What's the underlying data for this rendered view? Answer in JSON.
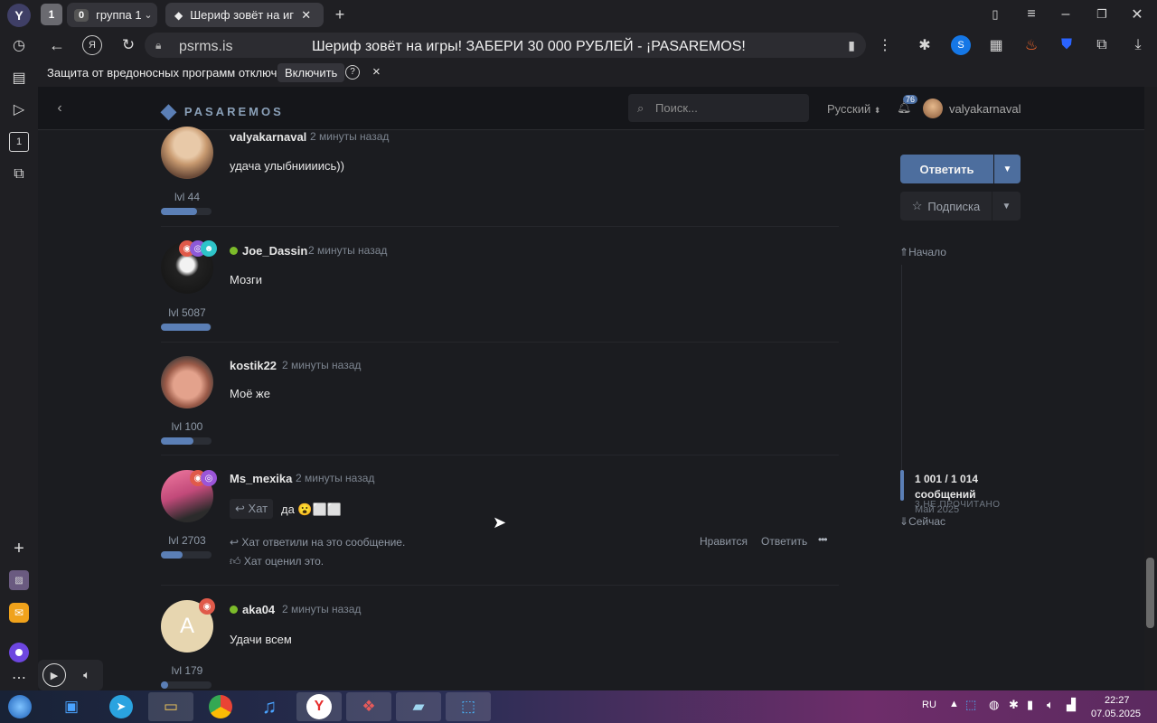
{
  "browser": {
    "group_tab": {
      "count": "1",
      "badge": "0",
      "label": "группа 1"
    },
    "active_tab": {
      "title": "Шериф зовёт на иг"
    },
    "address": {
      "host": "psrms.is",
      "page_title": "Шериф зовёт на игры! ЗАБЕРИ 30 000 РУБЛЕЙ - ¡PASAREMOS!"
    },
    "security_bar": {
      "message": "Защита от вредоносных программ отключена",
      "enable": "Включить",
      "help": "?",
      "close": "×"
    }
  },
  "site": {
    "logo": "PASAREMOS",
    "search_placeholder": "Поиск...",
    "language": "Русский",
    "notifications": "76",
    "username": "valyakarnaval"
  },
  "posts": [
    {
      "user": "valyakarnaval",
      "time": "2 минуты назад",
      "text": "удача улыбниииись))",
      "level": "lvl 44",
      "progress": 0.72,
      "online": false
    },
    {
      "user": "Joe_Dassin",
      "time": "2 минуты назад",
      "text": "Мозги",
      "level": "lvl 5087",
      "progress": 0.98,
      "online": true
    },
    {
      "user": "kostik22",
      "time": "2 минуты назад",
      "text": "Моё же",
      "level": "lvl 100",
      "progress": 0.64,
      "online": false
    },
    {
      "user": "Ms_mexika",
      "time": "2 минуты назад",
      "quote_user": "Хат",
      "text": "да 😮⬜⬜",
      "level": "lvl 2703",
      "progress": 0.42,
      "online": false,
      "replied_note": "Хат ответили на это сообщение.",
      "liked_note": "Хат оценил это.",
      "like": "Нравится",
      "reply": "Ответить",
      "more": "•••"
    },
    {
      "user": "aka04",
      "time": "2 минуты назад",
      "text": "Удачи всем",
      "level": "lvl 179",
      "progress": 0.14,
      "online": true,
      "avatar_letter": "A"
    }
  ],
  "sidebar": {
    "reply_button": "Ответить",
    "subscribe_button": "Подписка",
    "start": "Начало",
    "counter": "1 001 / 1 014",
    "counter_unit": "сообщений",
    "unread": "3 НЕ ПРОЧИТАНО",
    "date_hint": "Май 2025",
    "now": "Сейчас"
  },
  "taskbar": {
    "lang": "RU",
    "time": "22:27",
    "date": "07.05.2025"
  }
}
